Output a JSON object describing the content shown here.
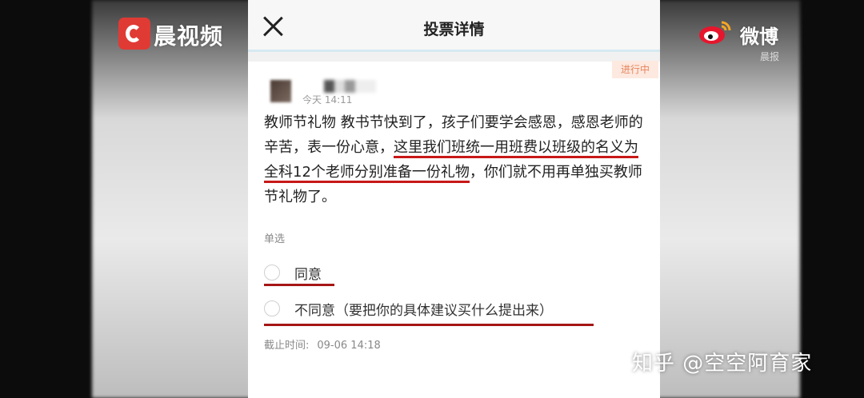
{
  "header": {
    "title": "投票详情",
    "close_icon": "close-icon"
  },
  "status": {
    "label": "进行中",
    "color": "#e7855b"
  },
  "post": {
    "time": "今天 14:11",
    "text_part1": "教师节礼物 教书节快到了，孩子们要学会感恩，感恩老师的辛苦，表一份心意，",
    "text_highlight": "这里我们班统一用班费以班级的名义为全科12个老师分别准备一份礼物",
    "text_part2": "，你们就不用再单独买教师节礼物了。"
  },
  "poll": {
    "type_label": "单选",
    "options": [
      {
        "label": "同意"
      },
      {
        "label": "不同意（要把你的具体建议买什么提出来）"
      }
    ],
    "deadline_label": "截止时间:",
    "deadline_value": "09-06 14:18"
  },
  "watermarks": {
    "left_logo_text": "晨视频",
    "right_logo_text": "微博",
    "right_logo_sub": "晨报",
    "zhihu_text": "知乎 @空空阿育家"
  },
  "colors": {
    "highlight_underline": "#c81818",
    "left_logo": "#e03a34"
  }
}
